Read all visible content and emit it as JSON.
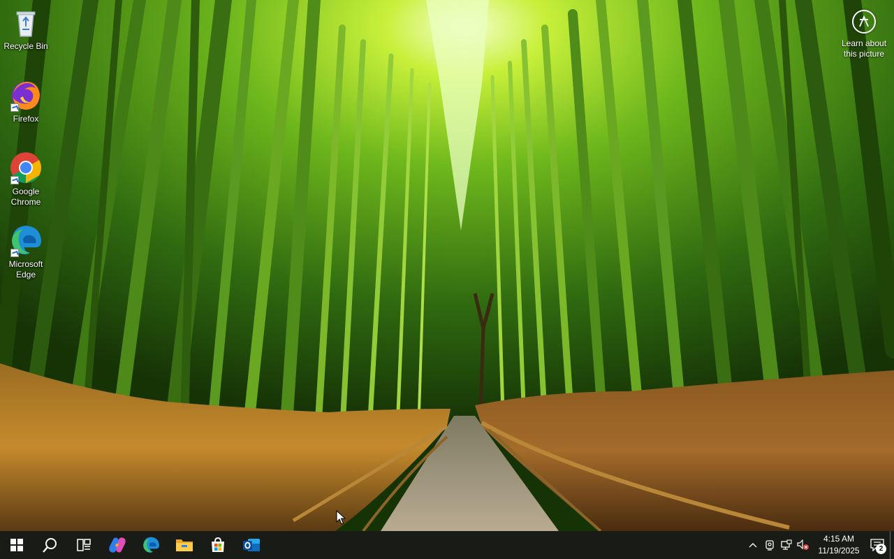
{
  "desktop": {
    "icons": [
      {
        "label": "Recycle Bin",
        "icon": "recycle-bin-icon"
      },
      {
        "label": "Firefox",
        "icon": "firefox-icon"
      },
      {
        "label": "Google Chrome",
        "icon": "chrome-icon"
      },
      {
        "label": "Microsoft Edge",
        "icon": "edge-icon"
      }
    ],
    "learn_about_picture": {
      "label": "Learn about this picture",
      "icon": "camera-circle-icon"
    }
  },
  "taskbar": {
    "pinned": [
      {
        "name": "Start",
        "icon": "windows-start-icon"
      },
      {
        "name": "Search",
        "icon": "search-icon"
      },
      {
        "name": "Task View",
        "icon": "task-view-icon"
      },
      {
        "name": "Copilot",
        "icon": "copilot-icon"
      },
      {
        "name": "Microsoft Edge",
        "icon": "edge-icon"
      },
      {
        "name": "File Explorer",
        "icon": "folder-icon"
      },
      {
        "name": "Microsoft Store",
        "icon": "store-icon"
      },
      {
        "name": "Outlook",
        "icon": "outlook-icon"
      }
    ],
    "tray": {
      "time": "4:15 AM",
      "date": "11/19/2025",
      "notification_count": "2"
    }
  },
  "colors": {
    "taskbar_bg": "#191b16",
    "accent": "#2d6fd1"
  }
}
